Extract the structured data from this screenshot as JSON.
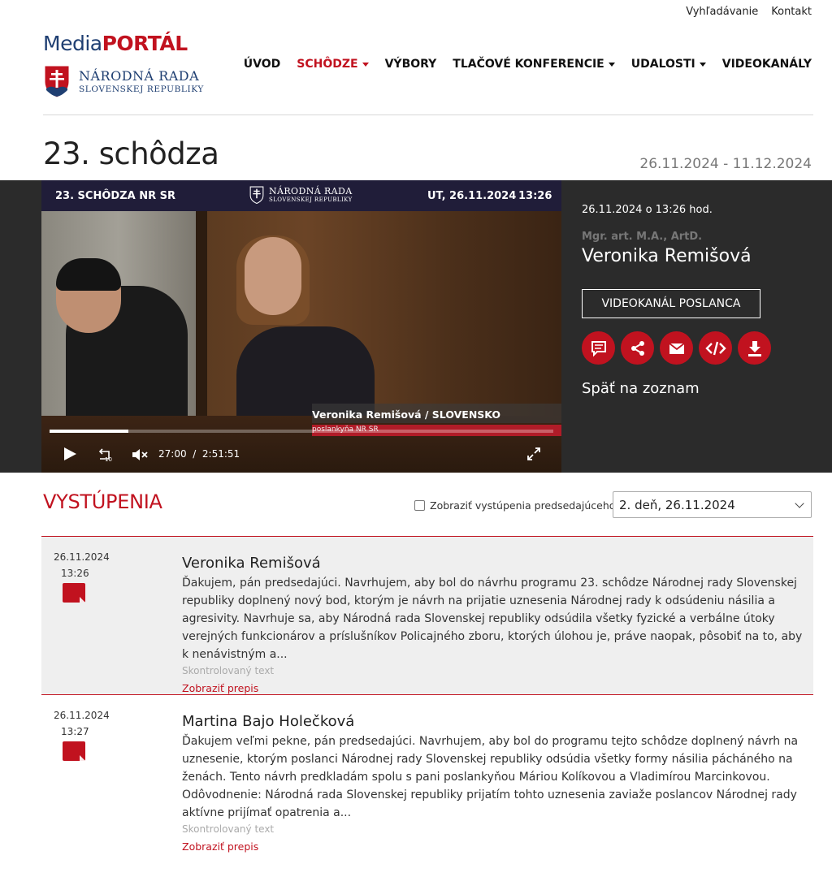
{
  "top_links": {
    "search": "Vyhľadávanie",
    "contact": "Kontakt"
  },
  "logo": {
    "media": "Media",
    "portal": "PORTÁL",
    "line1": "NÁRODNÁ RADA",
    "line2": "SLOVENSKEJ REPUBLIKY"
  },
  "nav": [
    {
      "label": "ÚVOD",
      "dropdown": false,
      "active": false
    },
    {
      "label": "SCHÔDZE",
      "dropdown": true,
      "active": true
    },
    {
      "label": "VÝBORY",
      "dropdown": false,
      "active": false
    },
    {
      "label": "TLAČOVÉ KONFERENCIE",
      "dropdown": true,
      "active": false
    },
    {
      "label": "UDALOSTI",
      "dropdown": true,
      "active": false
    },
    {
      "label": "VIDEOKANÁLY",
      "dropdown": false,
      "active": false
    }
  ],
  "page": {
    "title": "23. schôdza",
    "dates": "26.11.2024 - 11.12.2024"
  },
  "video": {
    "banner_left": "23. SCHÔDZA NR SR",
    "banner_logo_1": "NÁRODNÁ RADA",
    "banner_logo_2": "SLOVENSKEJ REPUBLIKY",
    "banner_date": "UT, 26.11.2024",
    "banner_time": "13:26",
    "caption_name": "Veronika Remišová / SLOVENSKO",
    "caption_role": "poslankyňa NR SR",
    "current_time": "27:00",
    "time_separator": "/",
    "duration": "2:51:51",
    "progress_fraction": 0.157,
    "rewind_label": "10"
  },
  "speaker": {
    "datetime": "26.11.2024 o 13:26 hod.",
    "degree": "Mgr. art. M.A., ArtD.",
    "name": "Veronika Remišová",
    "channel_button": "VIDEOKANÁL POSLANCA",
    "back_link": "Späť na zoznam",
    "actions": [
      "comment-icon",
      "share-icon",
      "mail-icon",
      "embed-icon",
      "download-icon"
    ]
  },
  "speeches_section": {
    "title": "VYSTÚPENIA",
    "checkbox_label": "Zobraziť vystúpenia predsedajúceho",
    "day_select": "2. deň, 26.11.2024"
  },
  "speeches": [
    {
      "date": "26.11.2024",
      "time": "13:26",
      "name": "Veronika Remišová",
      "text": "Ďakujem, pán predsedajúci. Navrhujem, aby bol do návrhu programu 23. schôdze Národnej rady Slovenskej republiky doplnený nový bod, ktorým je návrh na prijatie uznesenia Národnej rady k odsúdeniu násilia a agresivity. Navrhuje sa, aby Národná rada Slovenskej republiky odsúdila všetky fyzické a verbálne útoky verejných funkcionárov a príslušníkov Policajného zboru, ktorých úlohou je, práve naopak, pôsobiť na to, aby k nenávistným a...",
      "status": "Skontrolovaný text",
      "link": "Zobraziť prepis"
    },
    {
      "date": "26.11.2024",
      "time": "13:27",
      "name": "Martina Bajo Holečková",
      "text": "Ďakujem veľmi pekne, pán predsedajúci. Navrhujem, aby bol do programu tejto schôdze doplnený návrh na uznesenie, ktorým poslanci Národnej rady Slovenskej republiky odsúdia všetky formy násilia pácháného na ženách. Tento návrh predkladám spolu s pani poslankyňou Máriou Kolíkovou a Vladimírou Marcinkovou. Odôvodnenie: Národná rada Slovenskej republiky prijatím tohto uznesenia zaviaže poslancov Národnej rady aktívne prijímať opatrenia a...",
      "status": "Skontrolovaný text",
      "link": "Zobraziť prepis"
    }
  ],
  "colors": {
    "accent": "#c1121f",
    "brand_blue": "#1f3f72",
    "dark_band": "#2b2b2b"
  }
}
